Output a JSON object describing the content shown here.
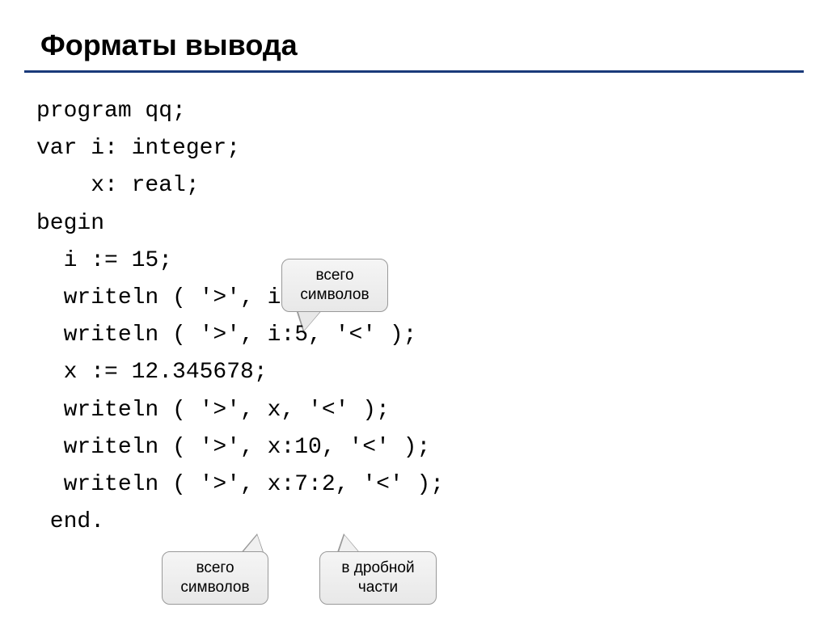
{
  "title": "Форматы вывода",
  "code": {
    "line1": "program qq;",
    "line2": "var i: integer;",
    "line3": "    x: real;",
    "line4": "begin",
    "line5": "  i := 15;",
    "line6": "  writeln ( '>', i, '<' );",
    "line7": "  writeln ( '>', i:5, '<' );",
    "line8": "  x := 12.345678;",
    "line9": "  writeln ( '>', x, '<' );",
    "line10": "  writeln ( '>', x:10, '<' );",
    "line11": "  writeln ( '>', x:7:2, '<' );",
    "line12": " end."
  },
  "callouts": {
    "total_chars1": "всего символов",
    "total_chars2": "всего символов",
    "fractional": "в дробной части"
  }
}
